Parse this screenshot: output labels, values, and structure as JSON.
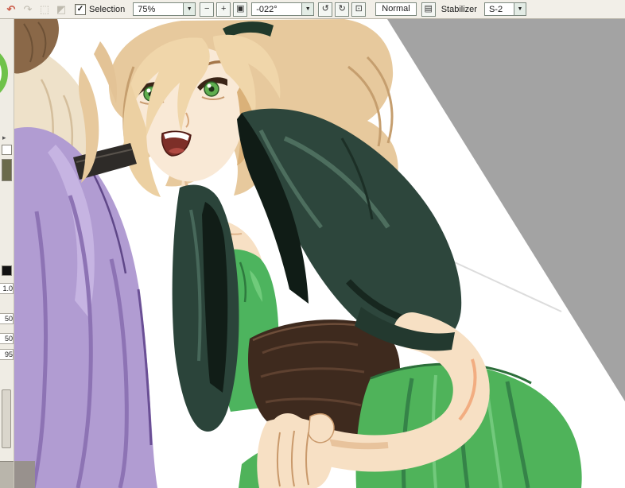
{
  "toolbar": {
    "selection": {
      "label": "Selection",
      "checked": "✓"
    },
    "zoom": {
      "value": "75%"
    },
    "buttons": {
      "zoom_out": "−",
      "zoom_in": "+"
    },
    "angle": {
      "value": "-022°"
    },
    "blend_mode": "Normal",
    "stabilizer": {
      "label": "Stabilizer",
      "value": "S-2"
    },
    "icons": {
      "undo": "↶",
      "redo": "↷",
      "deselect": "⬚",
      "invert_selection": "◩",
      "dropdown": "▼",
      "zoom_reset": "▣",
      "rotate_ccw": "↺",
      "rotate_cw": "↻",
      "rotate_reset": "⊡",
      "panel_toggle": "▤"
    }
  },
  "left_panel": {
    "arrow": "▸",
    "values": [
      "1.0",
      "50",
      "50",
      "95"
    ],
    "swatch_olive": "#6b6b4a",
    "swatch_black": "#111111"
  },
  "artwork": {
    "palette": {
      "outside_gray": "#a3a3a3",
      "hair_blonde": "#e7c99d",
      "hair_brown": "#8a6848",
      "skin": "#f7e0c4",
      "eye_green": "#5fae4f",
      "shirt_teal": "#2d463c",
      "top_green": "#4db45e",
      "skirt_green": "#4fb35a",
      "corset_brown": "#3e2a1e",
      "jacket_purple": "#b19cd2",
      "shirt_cream": "#eee1c9",
      "canvas_white": "#ffffff"
    }
  }
}
